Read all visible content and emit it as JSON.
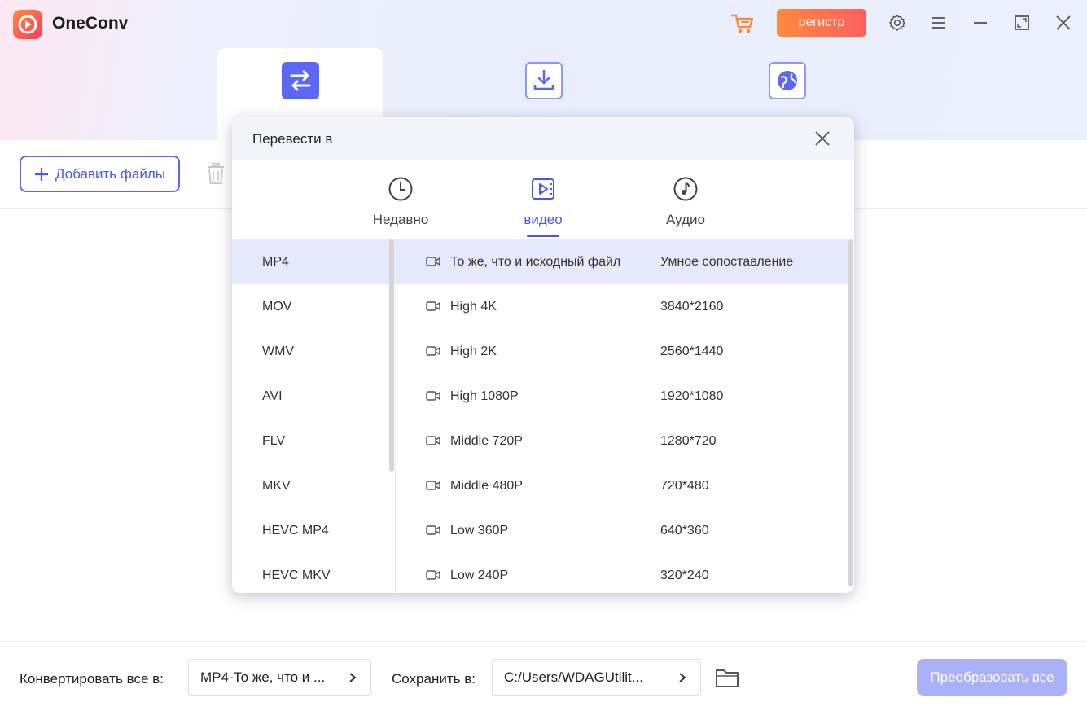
{
  "app": {
    "title": "OneConv"
  },
  "header": {
    "register_label": "регистр"
  },
  "mode_tabs": [
    {
      "label": ""
    },
    {
      "label": ""
    },
    {
      "label": ""
    }
  ],
  "toolbar": {
    "add_files_label": "Добавить файлы"
  },
  "dialog": {
    "title": "Перевести в",
    "categories": [
      {
        "label": "Недавно",
        "icon": "clock-icon"
      },
      {
        "label": "видео",
        "icon": "video-icon"
      },
      {
        "label": "Аудио",
        "icon": "music-icon"
      }
    ],
    "formats": [
      "MP4",
      "MOV",
      "WMV",
      "AVI",
      "FLV",
      "MKV",
      "HEVC MP4",
      "HEVC MKV"
    ],
    "presets": [
      {
        "name": "То же, что и исходный файл",
        "resolution": "Умное сопоставление"
      },
      {
        "name": "High 4K",
        "resolution": "3840*2160"
      },
      {
        "name": "High 2K",
        "resolution": "2560*1440"
      },
      {
        "name": "High 1080P",
        "resolution": "1920*1080"
      },
      {
        "name": "Middle 720P",
        "resolution": "1280*720"
      },
      {
        "name": "Middle 480P",
        "resolution": "720*480"
      },
      {
        "name": "Low 360P",
        "resolution": "640*360"
      },
      {
        "name": "Low 240P",
        "resolution": "320*240"
      }
    ]
  },
  "bottom": {
    "convert_all_label": "Конвертировать все в:",
    "convert_all_value": "MP4-То же, что и ...",
    "save_to_label": "Сохранить в:",
    "save_to_value": "C:/Users/WDAGUtilit...",
    "convert_button": "Преобразовать все"
  },
  "colors": {
    "accent": "#5a68f5",
    "accent_text": "#4b57e8",
    "register_gradient_start": "#ff8a3d",
    "register_gradient_end": "#ff5f5f",
    "selected_row": "#e6e8fb",
    "disabled_button": "#a9b1f8"
  }
}
